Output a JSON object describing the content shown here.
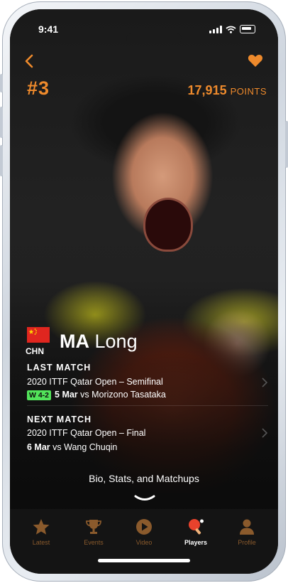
{
  "status_bar": {
    "time": "9:41"
  },
  "header": {
    "rank": "#3",
    "points_value": "17,915",
    "points_unit": "POINTS"
  },
  "player": {
    "country_code": "CHN",
    "last_name": "MA",
    "first_name": "Long"
  },
  "last_match": {
    "heading": "LAST MATCH",
    "event": "2020 ITTF Qatar Open – Semifinal",
    "result_badge": "W 4-2",
    "date": "5 Mar",
    "vs_text": "vs Morizono Tasataka"
  },
  "next_match": {
    "heading": "NEXT MATCH",
    "event": "2020 ITTF Qatar Open – Final",
    "date": "6 Mar",
    "vs_text": "vs Wang Chuqin"
  },
  "bio_link": "Bio, Stats, and Matchups",
  "tabs": [
    {
      "label": "Latest",
      "icon": "star-icon"
    },
    {
      "label": "Events",
      "icon": "trophy-icon"
    },
    {
      "label": "Video",
      "icon": "play-icon"
    },
    {
      "label": "Players",
      "icon": "ping-pong-icon",
      "active": true
    },
    {
      "label": "Profile",
      "icon": "person-icon"
    }
  ],
  "colors": {
    "accent": "#ee8a2c",
    "win_badge": "#52e35a",
    "background": "#0b0b0b",
    "flag_red": "#e0261f"
  }
}
